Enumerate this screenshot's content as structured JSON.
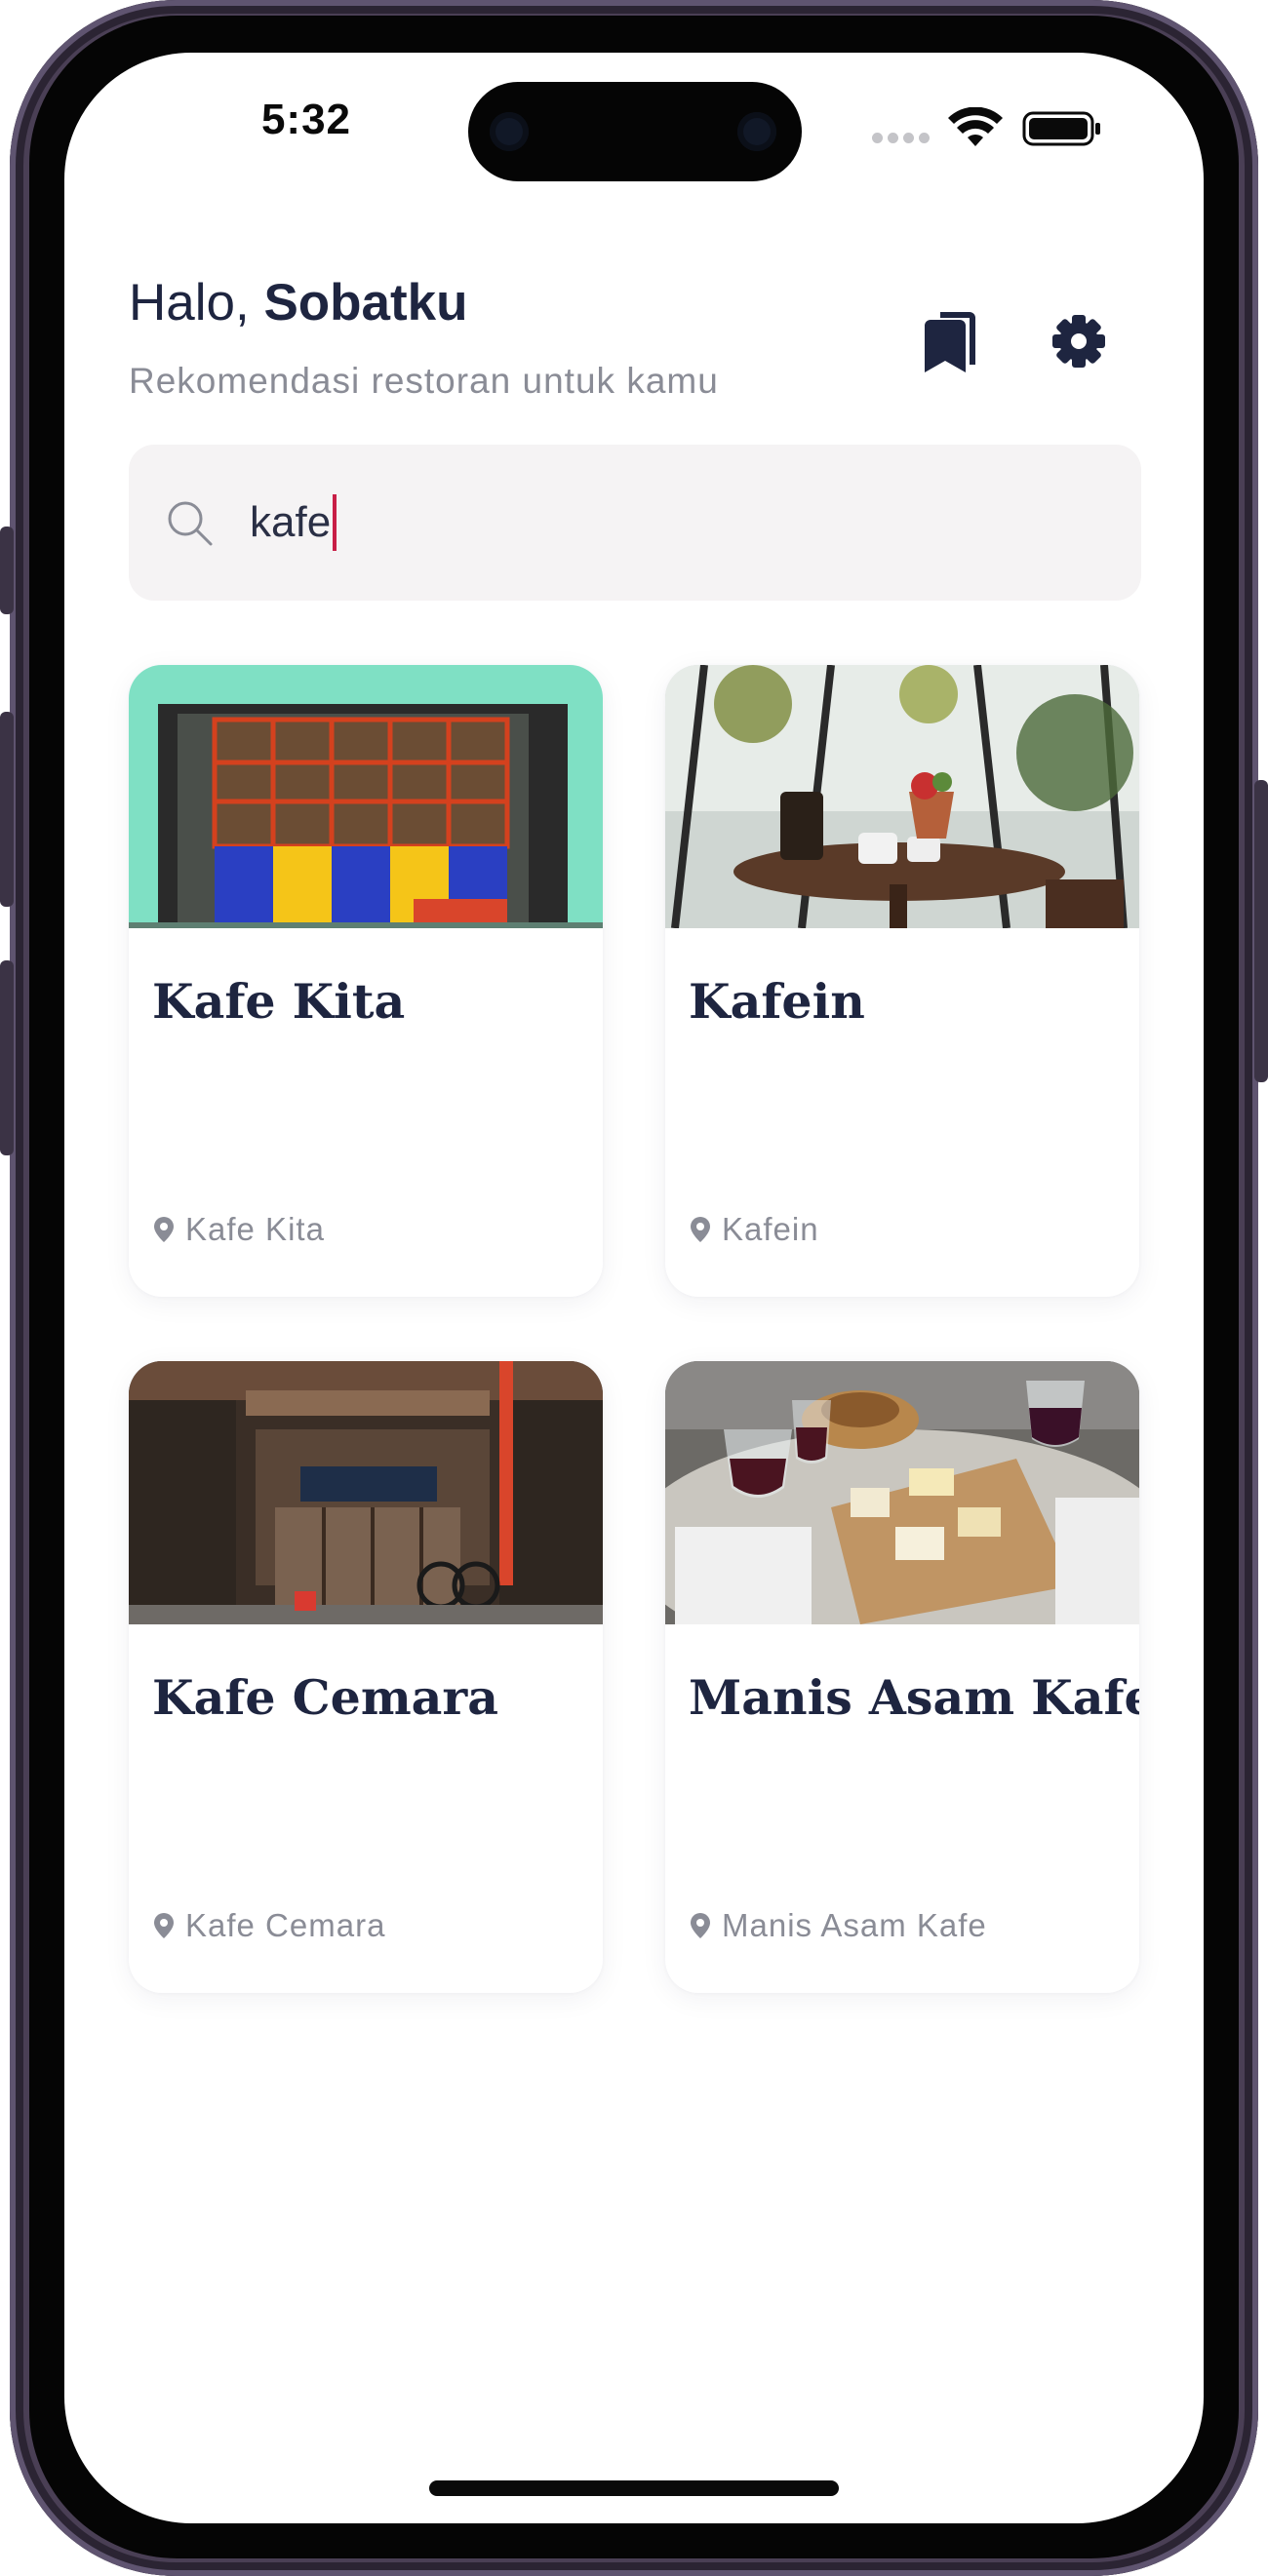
{
  "status_bar": {
    "time": "5:32"
  },
  "header": {
    "greeting_prefix": "Halo, ",
    "greeting_name": "Sobatku",
    "subtitle": "Rekomendasi restoran untuk kamu"
  },
  "search": {
    "value": "kafe"
  },
  "restaurants": [
    {
      "name": "Kafe Kita",
      "location": "Kafe Kita"
    },
    {
      "name": "Kafein",
      "location": "Kafein"
    },
    {
      "name": "Kafe Cemara",
      "location": "Kafe Cemara"
    },
    {
      "name": "Manis Asam Kafe",
      "location": "Manis Asam Kafe"
    }
  ],
  "colors": {
    "primary_text": "#1e2540",
    "secondary_text": "#8a8c96",
    "search_background": "#f5f3f4",
    "caret": "#c81e46"
  },
  "icons": {
    "bookmark": "bookmark-icon",
    "settings": "gear-icon",
    "search": "search-icon",
    "location": "map-pin-icon"
  }
}
